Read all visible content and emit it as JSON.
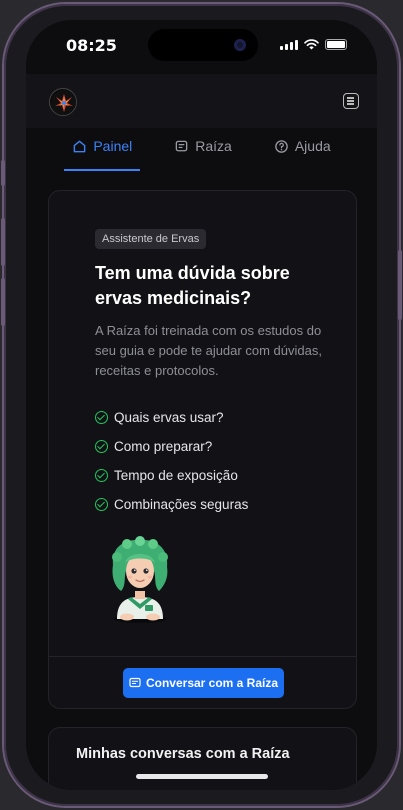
{
  "status_bar": {
    "time": "08:25"
  },
  "tabs": [
    {
      "label": "Painel",
      "icon": "home-icon",
      "active": true
    },
    {
      "label": "Raíza",
      "icon": "chat-icon",
      "active": false
    },
    {
      "label": "Ajuda",
      "icon": "help-circle-icon",
      "active": false
    }
  ],
  "assistant_card": {
    "badge": "Assistente de Ervas",
    "title": "Tem uma dúvida sobre ervas medicinais?",
    "description": "A Raíza foi treinada com os estudos do seu guia e pode te ajudar com dúvidas, receitas e protocolos.",
    "features": [
      "Quais ervas usar?",
      "Como preparar?",
      "Tempo de exposição",
      "Combinações seguras"
    ],
    "cta_label": "Conversar com a Raíza"
  },
  "conversations_card": {
    "title": "Minhas conversas com a Raíza"
  },
  "colors": {
    "accent": "#1d6ff2",
    "tab_active": "#3b82f6",
    "check": "#22c55e",
    "background": "#0d0d10"
  }
}
